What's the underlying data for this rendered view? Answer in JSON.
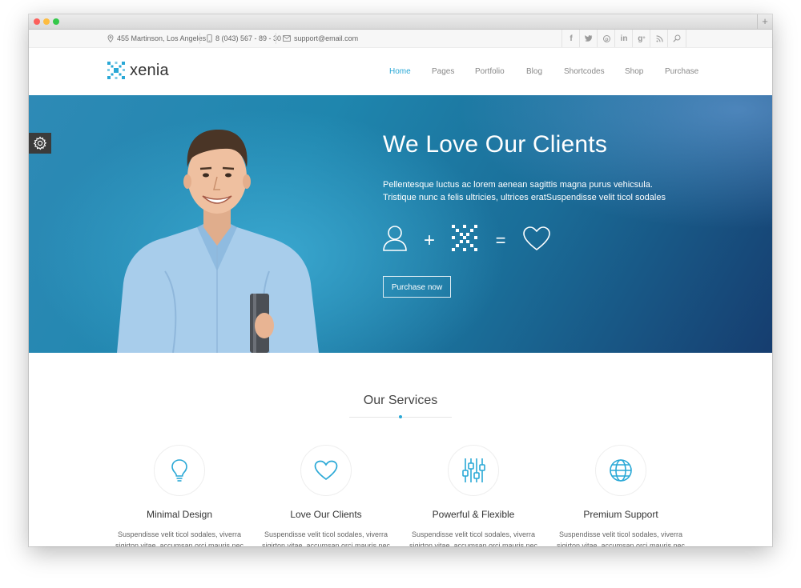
{
  "topbar": {
    "address": "455 Martinson, Los Angeles",
    "phone": "8 (043) 567 - 89 - 30",
    "email": "support@email.com",
    "social": [
      "facebook-icon",
      "twitter-icon",
      "pinterest-icon",
      "linkedin-icon",
      "googleplus-icon",
      "rss-icon",
      "search-icon"
    ]
  },
  "logo": {
    "text": "xenia"
  },
  "nav": {
    "items": [
      {
        "label": "Home",
        "active": true
      },
      {
        "label": "Pages"
      },
      {
        "label": "Portfolio"
      },
      {
        "label": "Blog"
      },
      {
        "label": "Shortcodes"
      },
      {
        "label": "Shop"
      },
      {
        "label": "Purchase"
      }
    ]
  },
  "hero": {
    "title": "We Love Our Clients",
    "text_line1": "Pellentesque luctus ac lorem aenean sagittis magna purus vehicsula.",
    "text_line2": "Tristique nunc a felis ultricies, ultrices eratSuspendisse velit ticol sodales",
    "plus": "+",
    "equals": "=",
    "button": "Purchase now"
  },
  "services": {
    "title": "Our Services",
    "items": [
      {
        "icon": "lightbulb-icon",
        "title": "Minimal Design",
        "line1": "Suspendisse velit ticol sodales, viverra",
        "line2": "sigirton vitae, accumsan orci mauris nec"
      },
      {
        "icon": "heart-icon",
        "title": "Love Our Clients",
        "line1": "Suspendisse velit ticol sodales, viverra",
        "line2": "sigirton vitae, accumsan orci mauris nec"
      },
      {
        "icon": "sliders-icon",
        "title": "Powerful & Flexible",
        "line1": "Suspendisse velit ticol sodales, viverra",
        "line2": "sigirton vitae, accumsan orci mauris nec"
      },
      {
        "icon": "globe-icon",
        "title": "Premium Support",
        "line1": "Suspendisse velit ticol sodales, viverra",
        "line2": "sigirton vitae, accumsan orci mauris nec"
      }
    ]
  },
  "colors": {
    "accent": "#29a8d6",
    "hero_start": "#2e8ab6",
    "hero_end": "#163d6f"
  }
}
